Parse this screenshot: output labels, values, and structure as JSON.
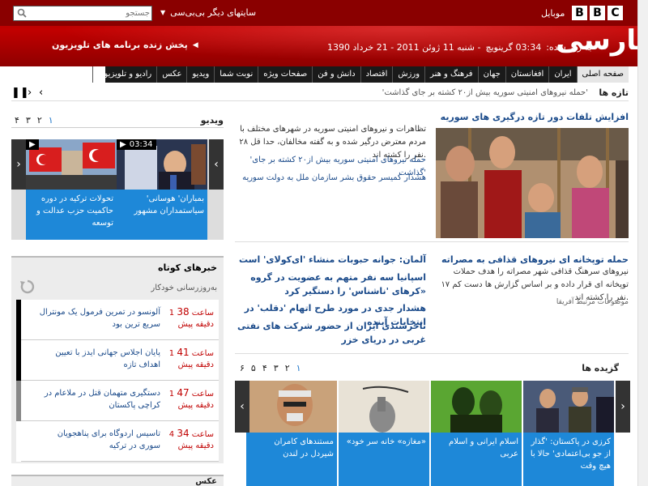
{
  "header": {
    "brand_letters": [
      "B",
      "B",
      "C"
    ],
    "mobile": "موبایل",
    "other_sites": "سایتهای دیگر بی‌بی‌سی",
    "search_placeholder": "جستجو",
    "site_title": "فارسی",
    "updated_label": "به روز شده:",
    "updated_time": "03:34 گرینویچ",
    "date_text": "- شنبه 11 ژوئن 2011 - 21 خرداد 1390",
    "live_link": "پخش زنده برنامه های تلویزیون"
  },
  "nav": [
    "صفحه اصلی",
    "ایران",
    "افغانستان",
    "جهان",
    "فرهنگ و هنر",
    "ورزش",
    "اقتصاد",
    "دانش و فن",
    "صفحات ویژه",
    "نوبت شما",
    "ویدیو",
    "عکس",
    "رادیو و تلویزیون"
  ],
  "ticker": {
    "label": "تازه ها",
    "headline": "'حمله نیروهای امنیتی سوریه بیش از۲۰ کشته بر جای گذاشت'"
  },
  "video": {
    "title": "ویدیو",
    "pages": [
      "۱",
      "۲",
      "۳",
      "۴"
    ],
    "items": [
      {
        "caption": "'بمباران' هوسانی سیاستمداران مشهور",
        "time": "03:34"
      },
      {
        "caption": "تحولات ترکیه در دوره حاکمیت حزب عدالت و توسعه"
      }
    ]
  },
  "top_story": {
    "title": "افزایش تلفات دور تازه درگیری های سوریه",
    "summary": "تظاهرات و نیروهای امنیتی سوریه در شهرهای مختلف با مردم معترض درگیر شده و به گفته مخالفان، حدا قل ۲۸ نفر را کشته اند.",
    "links": [
      "'حمله نیروهای امنیتی سوریه بیش از۲۰ کشته بر جای گذاشت'",
      "هشدار کمیسر حقوق بشر سازمان ملل به دولت سوریه"
    ]
  },
  "stories": [
    {
      "title": "حمله توپخانه ای نیروهای قذافی به مصراته",
      "body": "نیروهای سرهنگ قذافی شهر مصراته را هدف حملات توپخانه ای قرار داده و بر اساس گزارش ها دست کم ۱۷ نفر را کشته اند.",
      "related": "موضوعات مرتبط آفریقا"
    },
    {
      "links": [
        "آلمان: جوانه حبوبات منشاء 'ای‌کولای' است",
        "اسپانیا سه نفر متهم به عضویت در گروه «کرهای 'ناشناس' را دستگیر کرد",
        "هشدار جدی در مورد طرح اتهام 'دقلب' در انتخابات آینده",
        "ناخرسندی ایران از حضور شرکت های نفتی غربی در دریای خزر"
      ]
    }
  ],
  "short_news": {
    "title": "خبرهای کوتاه",
    "updating": "به‌روزرسانی خودکار",
    "items": [
      {
        "h": "1 ساعت",
        "m": "38",
        "ago": "دقیقه پیش",
        "headline": "آلونسو در تمرین فرمول یک مونترال سریع ترین بود"
      },
      {
        "h": "1 ساعت",
        "m": "41",
        "ago": "دقیقه پیش",
        "headline": "پایان اجلاس جهانی ایدز با تعیین اهداف تازه"
      },
      {
        "h": "1 ساعت",
        "m": "47",
        "ago": "دقیقه پیش",
        "headline": "دستگیری متهمان قتل در ملاعام در کراچی پاکستان"
      },
      {
        "h": "4 ساعت",
        "m": "34",
        "ago": "دقیقه پیش",
        "headline": "تاسیس اردوگاه برای پناهجویان سوری در ترکیه"
      }
    ]
  },
  "selected": {
    "title": "گزیده ها",
    "pages": [
      "۱",
      "۲",
      "۳",
      "۴",
      "۵",
      "۶"
    ],
    "items": [
      {
        "caption": "کرزی در پاکستان: 'گذار از جو بی‌اعتمادی' حالا با هیچ وقت"
      },
      {
        "caption": "اسلام ایرانی و اسلام عربی"
      },
      {
        "caption": "«مغازه» خانه سر خود»"
      },
      {
        "caption": "مستندهای کامران شیردل در لندن"
      }
    ]
  },
  "photo_box": {
    "title": "عکس"
  }
}
